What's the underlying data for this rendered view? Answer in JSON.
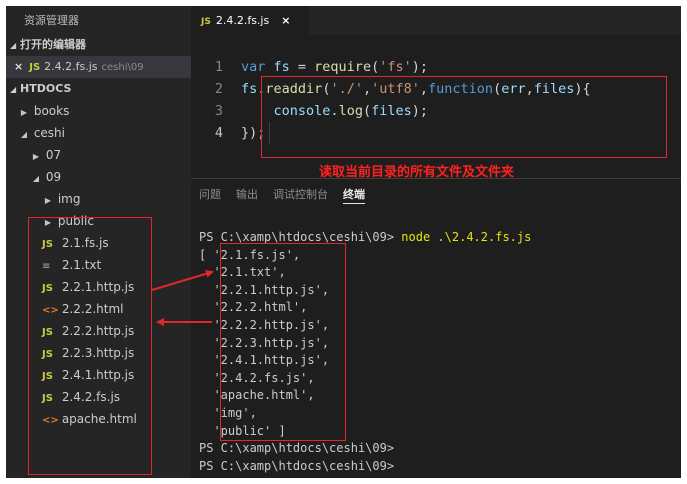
{
  "sidebar": {
    "title": "资源管理器",
    "open_editors_label": "打开的编辑器",
    "open_file": {
      "close": "×",
      "name": "2.4.2.fs.js",
      "dir": "ceshi\\09",
      "icon": "js-file-icon"
    },
    "project_label": "HTDOCS",
    "tree": [
      {
        "label": "books",
        "kind": "folder",
        "expanded": false,
        "depth": 0
      },
      {
        "label": "ceshi",
        "kind": "folder",
        "expanded": true,
        "depth": 0
      },
      {
        "label": "07",
        "kind": "folder",
        "expanded": false,
        "depth": 1
      },
      {
        "label": "09",
        "kind": "folder",
        "expanded": true,
        "depth": 1
      },
      {
        "label": "img",
        "kind": "folder",
        "expanded": false,
        "depth": 2
      },
      {
        "label": "public",
        "kind": "folder",
        "expanded": false,
        "depth": 2
      },
      {
        "label": "2.1.fs.js",
        "kind": "js",
        "depth": 2
      },
      {
        "label": "2.1.txt",
        "kind": "txt",
        "depth": 2
      },
      {
        "label": "2.2.1.http.js",
        "kind": "js",
        "depth": 2
      },
      {
        "label": "2.2.2.html",
        "kind": "html",
        "depth": 2
      },
      {
        "label": "2.2.2.http.js",
        "kind": "js",
        "depth": 2
      },
      {
        "label": "2.2.3.http.js",
        "kind": "js",
        "depth": 2
      },
      {
        "label": "2.4.1.http.js",
        "kind": "js",
        "depth": 2
      },
      {
        "label": "2.4.2.fs.js",
        "kind": "js",
        "depth": 2
      },
      {
        "label": "apache.html",
        "kind": "html",
        "depth": 2
      }
    ]
  },
  "editor": {
    "tab": {
      "icon_text": "JS",
      "name": "2.4.2.fs.js",
      "close": "×"
    },
    "lines": [
      {
        "n": "1",
        "tokens": [
          {
            "t": "var ",
            "c": "kw"
          },
          {
            "t": "fs",
            "c": "var"
          },
          {
            "t": " = ",
            "c": "pl"
          },
          {
            "t": "require",
            "c": "fn"
          },
          {
            "t": "(",
            "c": "pl"
          },
          {
            "t": "'fs'",
            "c": "str"
          },
          {
            "t": ");",
            "c": "pl"
          }
        ]
      },
      {
        "n": "2",
        "tokens": [
          {
            "t": "fs",
            "c": "var"
          },
          {
            "t": ".",
            "c": "pl"
          },
          {
            "t": "readdir",
            "c": "fn"
          },
          {
            "t": "(",
            "c": "pl"
          },
          {
            "t": "'./'",
            "c": "str"
          },
          {
            "t": ",",
            "c": "pl"
          },
          {
            "t": "'utf8'",
            "c": "str"
          },
          {
            "t": ",",
            "c": "pl"
          },
          {
            "t": "function",
            "c": "kw"
          },
          {
            "t": "(",
            "c": "pl"
          },
          {
            "t": "err",
            "c": "var"
          },
          {
            "t": ",",
            "c": "pl"
          },
          {
            "t": "files",
            "c": "var"
          },
          {
            "t": "){",
            "c": "pl"
          }
        ]
      },
      {
        "n": "3",
        "tokens": [
          {
            "t": "    ",
            "c": "pl"
          },
          {
            "t": "console",
            "c": "var"
          },
          {
            "t": ".",
            "c": "pl"
          },
          {
            "t": "log",
            "c": "fn"
          },
          {
            "t": "(",
            "c": "pl"
          },
          {
            "t": "files",
            "c": "var"
          },
          {
            "t": ");",
            "c": "pl"
          }
        ]
      },
      {
        "n": "4",
        "tokens": [
          {
            "t": "});",
            "c": "pl"
          }
        ]
      }
    ],
    "active_line": "4",
    "caption": "读取当前目录的所有文件及文件夹"
  },
  "panel": {
    "tabs": [
      {
        "label": "问题",
        "active": false
      },
      {
        "label": "输出",
        "active": false
      },
      {
        "label": "调试控制台",
        "active": false
      },
      {
        "label": "终端",
        "active": true
      }
    ],
    "terminal": {
      "prompt": "PS C:\\xamp\\htdocs\\ceshi\\09> ",
      "command": "node .\\2.4.2.fs.js",
      "output": [
        "[ '2.1.fs.js',",
        "  '2.1.txt',",
        "  '2.2.1.http.js',",
        "  '2.2.2.html',",
        "  '2.2.2.http.js',",
        "  '2.2.3.http.js',",
        "  '2.4.1.http.js',",
        "  '2.4.2.fs.js',",
        "  'apache.html',",
        "  'img',",
        "  'public' ]"
      ],
      "trailing_prompts": [
        "PS C:\\xamp\\htdocs\\ceshi\\09>",
        "PS C:\\xamp\\htdocs\\ceshi\\09>"
      ]
    }
  },
  "colors": {
    "annotation_red": "#e0282a",
    "js_icon": "#cbcb41",
    "html_icon": "#e37933"
  }
}
